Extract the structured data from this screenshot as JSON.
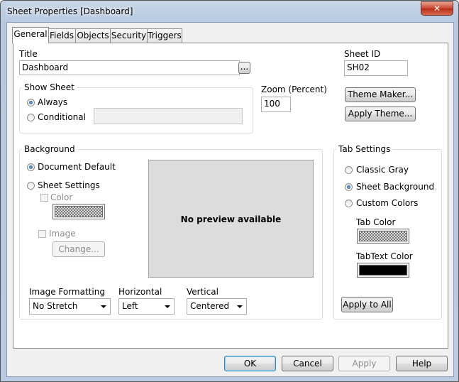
{
  "window": {
    "title": "Sheet Properties [Dashboard]",
    "close_glyph": "✕"
  },
  "tabs": [
    {
      "label": "General",
      "active": true
    },
    {
      "label": "Fields"
    },
    {
      "label": "Objects"
    },
    {
      "label": "Security"
    },
    {
      "label": "Triggers"
    }
  ],
  "title_field": {
    "label": "Title",
    "value": "Dashboard",
    "ellipsis_label": "..."
  },
  "sheet_id": {
    "label": "Sheet ID",
    "value": "SH02"
  },
  "show_sheet": {
    "group_label": "Show Sheet",
    "always_label": "Always",
    "conditional_label": "Conditional",
    "selected": "always"
  },
  "zoom": {
    "label": "Zoom (Percent)",
    "value": "100"
  },
  "theme": {
    "maker_label": "Theme Maker...",
    "apply_label": "Apply Theme..."
  },
  "background": {
    "group_label": "Background",
    "document_default_label": "Document Default",
    "sheet_settings_label": "Sheet Settings",
    "color_label": "Color",
    "image_label": "Image",
    "change_label": "Change...",
    "preview_text": "No preview available",
    "image_formatting_label": "Image Formatting",
    "image_formatting_value": "No Stretch",
    "horizontal_label": "Horizontal",
    "horizontal_value": "Left",
    "vertical_label": "Vertical",
    "vertical_value": "Centered"
  },
  "tab_settings": {
    "group_label": "Tab Settings",
    "classic_gray_label": "Classic Gray",
    "sheet_background_label": "Sheet Background",
    "custom_colors_label": "Custom Colors",
    "selected": "sheet_background",
    "tab_color_label": "Tab Color",
    "tab_text_color_label": "TabText Color",
    "tab_text_color": "#000000",
    "apply_to_all_label": "Apply to All"
  },
  "footer": {
    "ok_label": "OK",
    "cancel_label": "Cancel",
    "apply_label": "Apply",
    "help_label": "Help"
  }
}
